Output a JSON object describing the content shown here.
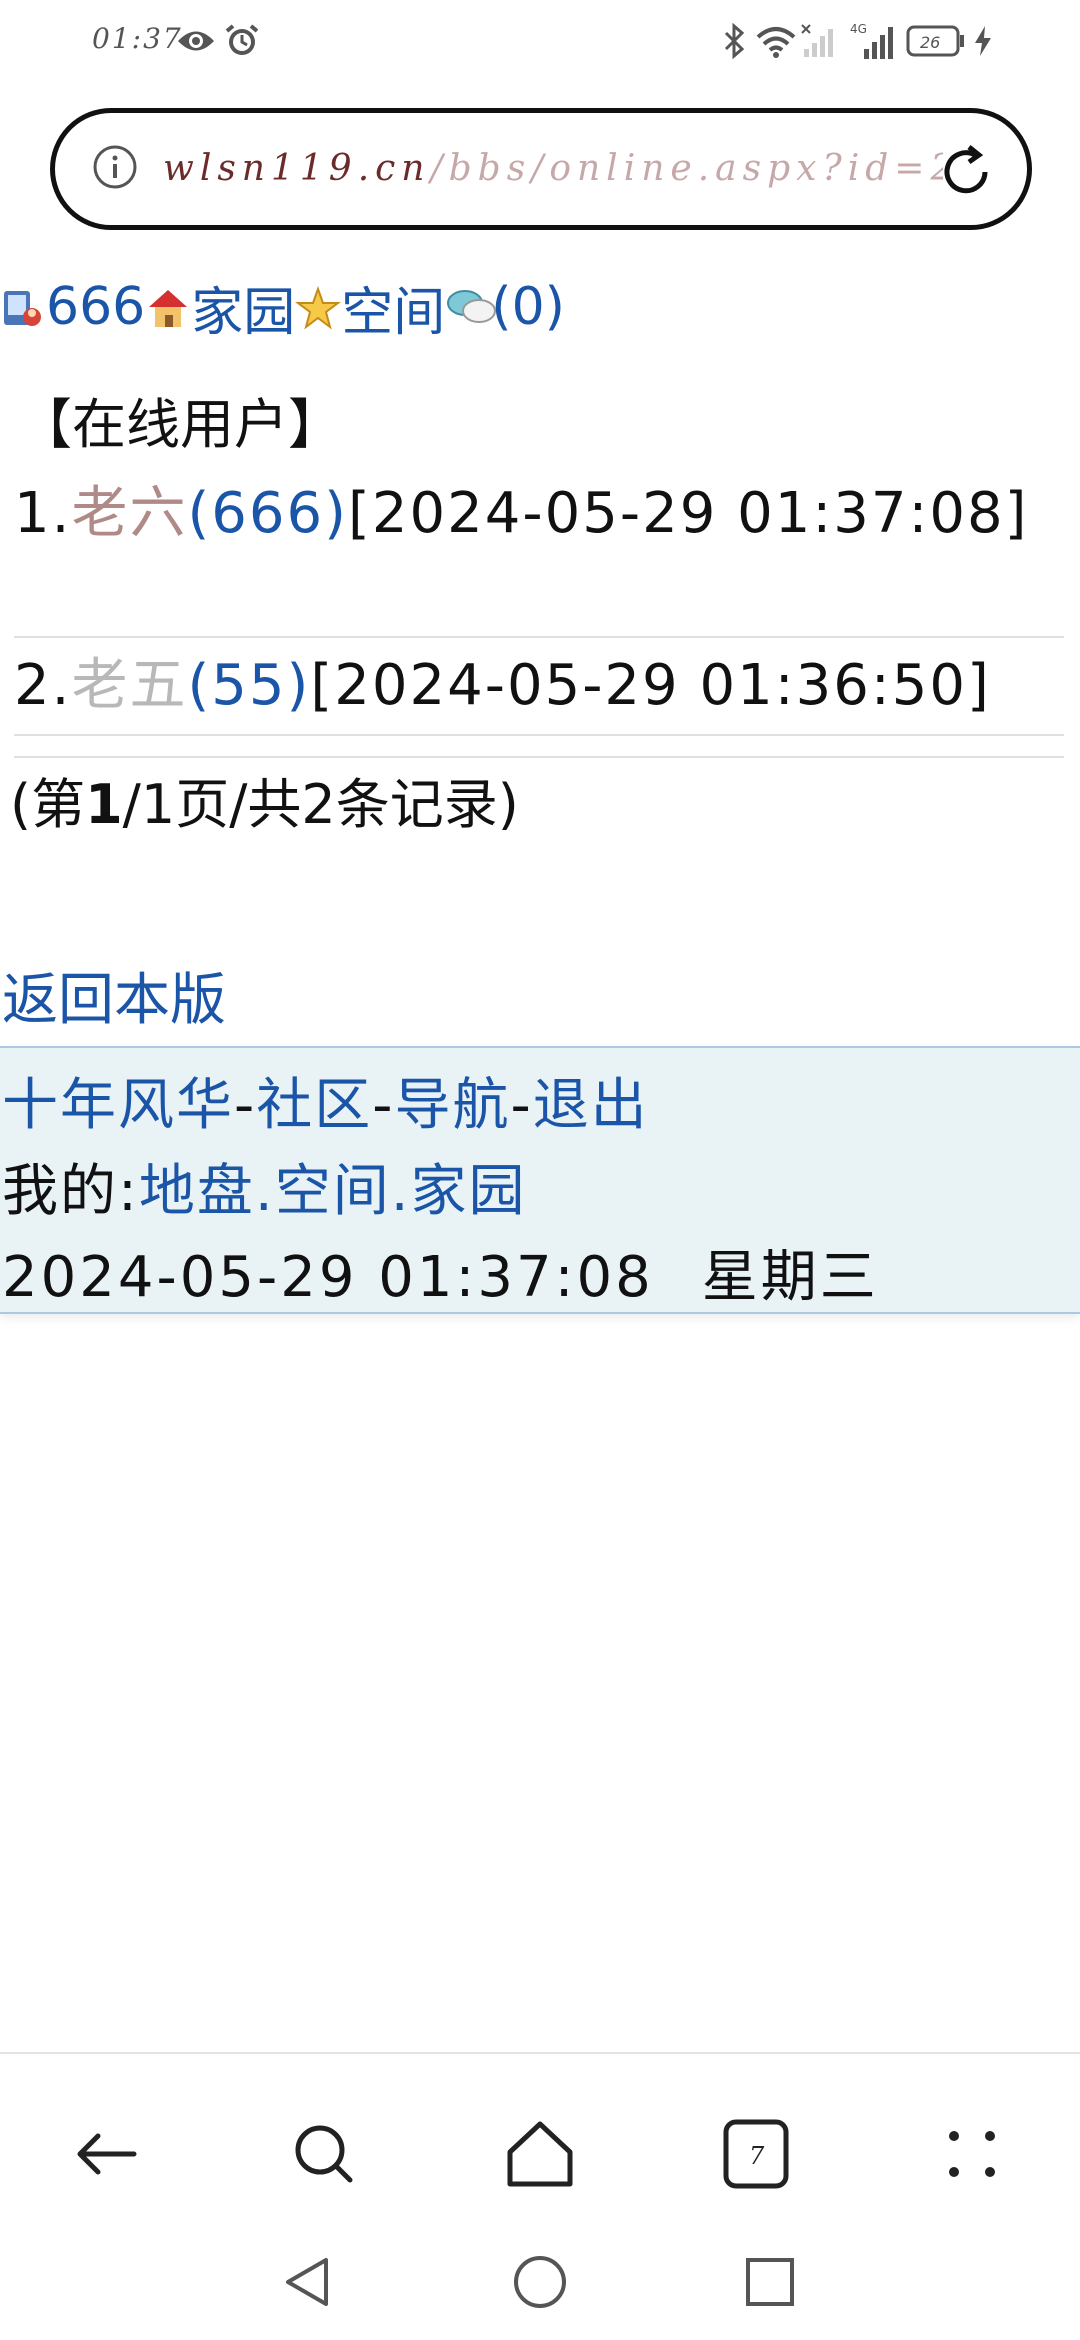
{
  "status_bar": {
    "time": "01:37",
    "network": "4G",
    "battery": "26",
    "icons": [
      "eye-icon",
      "alarm-icon",
      "bluetooth-icon",
      "wifi-icon",
      "signal-icon",
      "battery-icon",
      "charging-icon"
    ]
  },
  "url_bar": {
    "host": "wlsn119.cn",
    "path": "/bbs/online.aspx?id=2"
  },
  "top_nav": {
    "num": "666",
    "home": "家园",
    "space": "空间",
    "messages": "(0)"
  },
  "heading": "【在线用户】",
  "users": [
    {
      "index": "1.",
      "name": "老六",
      "id": "(666)",
      "time": "[2024-05-29 01:37:08]",
      "name_color": "#b08a86"
    },
    {
      "index": "2.",
      "name": "老五",
      "id": "(55)",
      "time": "[2024-05-29 01:36:50]",
      "name_color": "#b8b8b8"
    }
  ],
  "pager": {
    "open": "(第",
    "current": "1",
    "rest": "/1页/共2条记录)"
  },
  "back_link": "返回本版",
  "footer": {
    "links": [
      "十年风华",
      "社区",
      "导航",
      "退出"
    ],
    "sep": "-",
    "my_label": "我的:",
    "my_links": [
      "地盘",
      "空间",
      "家园"
    ],
    "dot": ".",
    "datetime": "2024-05-29 01:37:08",
    "weekday": "星期三"
  },
  "toolbar": {
    "tabs_count": "7"
  },
  "colors": {
    "link": "#1a55a8",
    "footer_bg": "#e9f3f6",
    "footer_border": "#a9c9e4"
  }
}
